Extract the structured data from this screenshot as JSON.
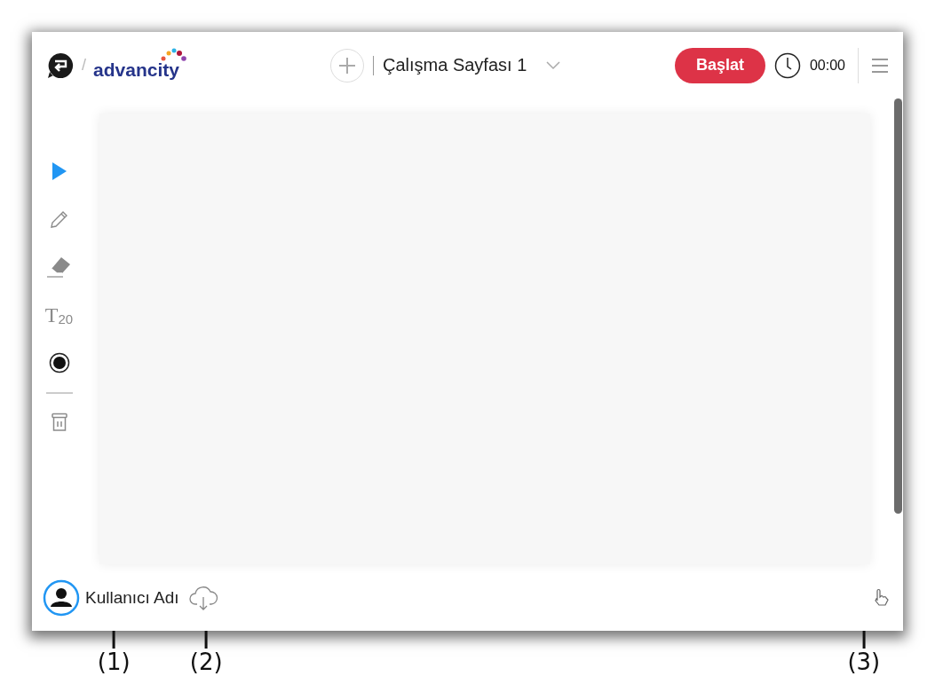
{
  "header": {
    "logo_separator": "/",
    "brand": "advancity",
    "page_title": "Çalışma Sayfası 1",
    "start_button": "Başlat",
    "timer": "00:00"
  },
  "tools": [
    {
      "kind": "select",
      "selected": true
    },
    {
      "kind": "pen",
      "selected": false
    },
    {
      "kind": "eraser",
      "selected": false
    },
    {
      "kind": "text",
      "glyph": "T",
      "size": "20",
      "selected": false
    },
    {
      "kind": "color",
      "color": "#111111",
      "selected": false
    },
    {
      "kind": "divider"
    },
    {
      "kind": "delete"
    }
  ],
  "footer": {
    "user_name": "Kullanıcı Adı"
  },
  "callouts": [
    {
      "label": "(1)"
    },
    {
      "label": "(2)"
    },
    {
      "label": "(3)"
    }
  ]
}
